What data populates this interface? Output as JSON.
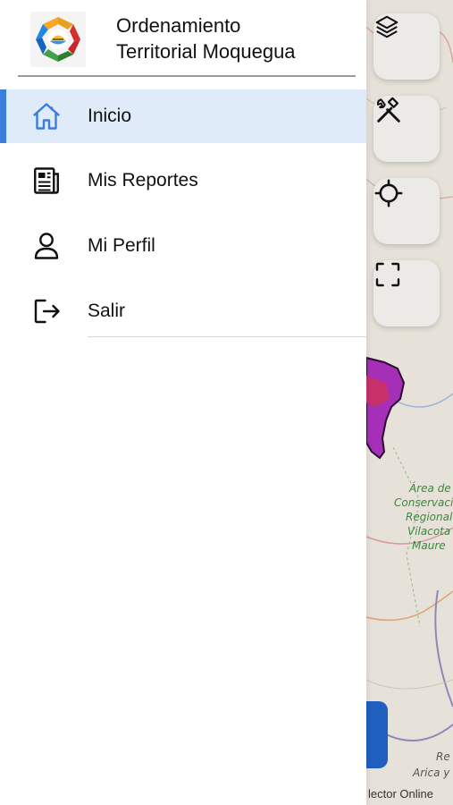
{
  "app": {
    "title_line1": "Ordenamiento",
    "title_line2": "Territorial Moquegua"
  },
  "menu": {
    "items": [
      {
        "label": "Inicio",
        "icon": "home-icon",
        "active": true
      },
      {
        "label": "Mis Reportes",
        "icon": "newspaper-icon",
        "active": false
      },
      {
        "label": "Mi Perfil",
        "icon": "user-icon",
        "active": false
      },
      {
        "label": "Salir",
        "icon": "logout-icon",
        "active": false
      }
    ]
  },
  "map": {
    "labels": {
      "area": "Área de",
      "conservacion": "Conservaci",
      "regional": "Regional",
      "vilacota": "Vilacota",
      "maure": "Maure",
      "re": "Re",
      "arica": "Arica y"
    },
    "credit": "lector Online",
    "buttons": [
      "layers-icon",
      "tools-icon",
      "locate-icon",
      "fullscreen-icon"
    ]
  },
  "colors": {
    "accent": "#3b7ddd",
    "active_bg": "#dfebf9",
    "map_polygon": "#a62fb8"
  }
}
